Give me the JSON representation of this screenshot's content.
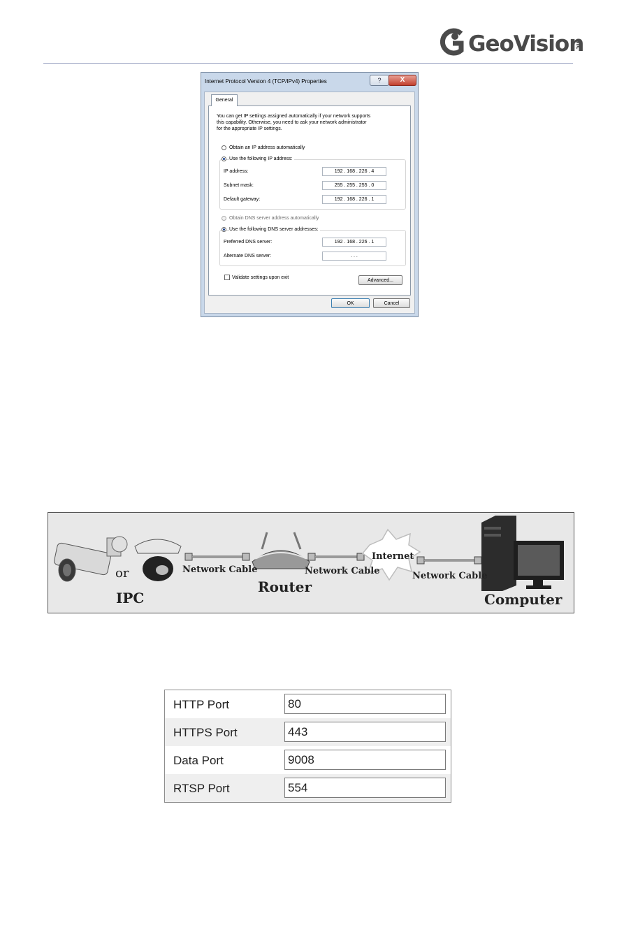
{
  "header": {
    "logo_text": "GeoVision",
    "logo_suffix": "inc"
  },
  "dialog": {
    "title": "Internet Protocol Version 4 (TCP/IPv4) Properties",
    "help_label": "?",
    "close_label": "X",
    "tab": "General",
    "intro_lines": [
      "You can get IP settings assigned automatically if your network supports",
      "this capability. Otherwise, you need to ask your network administrator",
      "for the appropriate IP settings."
    ],
    "ip_auto": "Obtain an IP address automatically",
    "ip_manual": "Use the following IP address:",
    "ip_address_label": "IP address:",
    "ip_address": "192 . 168 . 226 . 4",
    "subnet_label": "Subnet mask:",
    "subnet": "255 . 255 . 255 . 0",
    "gateway_label": "Default gateway:",
    "gateway": "192 . 168 . 226 . 1",
    "dns_auto": "Obtain DNS server address automatically",
    "dns_manual": "Use the following DNS server addresses:",
    "preferred_dns_label": "Preferred DNS server:",
    "preferred_dns": "192 . 168 . 226 . 1",
    "alternate_dns_label": "Alternate DNS server:",
    "alternate_dns": ".        .        .",
    "validate_label": "Validate settings upon exit",
    "advanced_button": "Advanced...",
    "ok_button": "OK",
    "cancel_button": "Cancel"
  },
  "diagram": {
    "or_label": "or",
    "ipc_label": "IPC",
    "cable_label_1": "Network Cable",
    "router_label": "Router",
    "cable_label_2": "Network Cable",
    "internet_label": "Internet",
    "cable_label_3": "Network Cable",
    "computer_label": "Computer"
  },
  "ports": [
    {
      "label": "HTTP Port",
      "value": "80"
    },
    {
      "label": "HTTPS Port",
      "value": "443"
    },
    {
      "label": "Data Port",
      "value": "9008"
    },
    {
      "label": "RTSP Port",
      "value": "554"
    }
  ]
}
